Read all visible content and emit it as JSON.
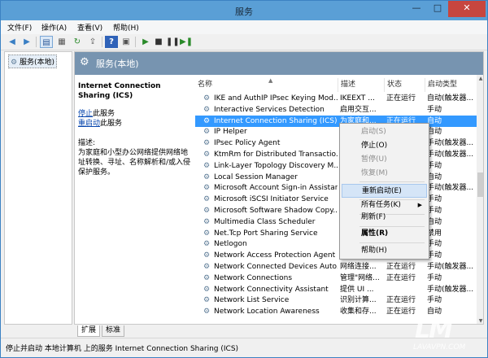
{
  "window": {
    "title": "服务",
    "min": "—",
    "max": "□",
    "close": "✕"
  },
  "menu": [
    "文件(F)",
    "操作(A)",
    "查看(V)",
    "帮助(H)"
  ],
  "tree": {
    "root_label": "服务(本地)"
  },
  "main_header": {
    "title": "服务(本地)"
  },
  "desc_panel": {
    "title": "Internet Connection Sharing (ICS)",
    "stop_link": "停止",
    "stop_suffix": "此服务",
    "restart_link": "重启动",
    "restart_suffix": "此服务",
    "desc_label": "描述:",
    "desc_text": "为家庭和小型办公网络提供网络地址转换、寻址、名称解析和/或入侵保护服务。"
  },
  "columns": {
    "name": "名称",
    "desc": "描述",
    "status": "状态",
    "startup": "启动类型"
  },
  "services": [
    {
      "name": "IKE and AuthIP IPsec Keying Mod...",
      "desc": "IKEEXT ...",
      "status": "正在运行",
      "startup": "自动(触发器..."
    },
    {
      "name": "Interactive Services Detection",
      "desc": "启用交互...",
      "status": "",
      "startup": "手动"
    },
    {
      "name": "Internet Connection Sharing (ICS)",
      "desc": "为家庭和...",
      "status": "正在运行",
      "startup": "自动"
    },
    {
      "name": "IP Helper",
      "desc": "",
      "status": "",
      "startup": "自动"
    },
    {
      "name": "IPsec Policy Agent",
      "desc": "",
      "status": "",
      "startup": "手动(触发器..."
    },
    {
      "name": "KtmRm for Distributed Transactio...",
      "desc": "",
      "status": "",
      "startup": "手动(触发器..."
    },
    {
      "name": "Link-Layer Topology Discovery M...",
      "desc": "",
      "status": "",
      "startup": "手动"
    },
    {
      "name": "Local Session Manager",
      "desc": "",
      "status": "",
      "startup": "自动"
    },
    {
      "name": "Microsoft Account Sign-in Assistant",
      "desc": "",
      "status": "",
      "startup": "手动(触发器..."
    },
    {
      "name": "Microsoft iSCSI Initiator Service",
      "desc": "",
      "status": "",
      "startup": "手动"
    },
    {
      "name": "Microsoft Software Shadow Copy...",
      "desc": "",
      "status": "",
      "startup": "手动"
    },
    {
      "name": "Multimedia Class Scheduler",
      "desc": "",
      "status": "",
      "startup": "自动"
    },
    {
      "name": "Net.Tcp Port Sharing Service",
      "desc": "",
      "status": "",
      "startup": "禁用"
    },
    {
      "name": "Netlogon",
      "desc": "",
      "status": "",
      "startup": "手动"
    },
    {
      "name": "Network Access Protection Agent",
      "desc": "",
      "status": "",
      "startup": "手动"
    },
    {
      "name": "Network Connected Devices Auto...",
      "desc": "网络连接...",
      "status": "正在运行",
      "startup": "手动(触发器..."
    },
    {
      "name": "Network Connections",
      "desc": "管理\"网络...",
      "status": "正在运行",
      "startup": "手动"
    },
    {
      "name": "Network Connectivity Assistant",
      "desc": "提供 UI ...",
      "status": "",
      "startup": "手动(触发器..."
    },
    {
      "name": "Network List Service",
      "desc": "识别计算...",
      "status": "正在运行",
      "startup": "手动"
    },
    {
      "name": "Network Location Awareness",
      "desc": "收集和存...",
      "status": "正在运行",
      "startup": "自动"
    }
  ],
  "context_menu": [
    {
      "label": "启动(S)",
      "disabled": true
    },
    {
      "label": "停止(O)",
      "disabled": false
    },
    {
      "label": "暂停(U)",
      "disabled": true
    },
    {
      "label": "恢复(M)",
      "disabled": true
    },
    {
      "label": "重新启动(E)",
      "disabled": false
    },
    {
      "label": "所有任务(K)",
      "disabled": false
    },
    {
      "label": "刷新(F)",
      "disabled": false
    },
    {
      "label": "属性(R)",
      "disabled": false
    },
    {
      "label": "帮助(H)",
      "disabled": false
    }
  ],
  "tabs": [
    "扩展",
    "标准"
  ],
  "status_bar": "停止并启动 本地计算机 上的服务 Internet Connection Sharing (ICS)",
  "watermark": {
    "logo": "LM",
    "url": "LAVAVPN.COM"
  }
}
